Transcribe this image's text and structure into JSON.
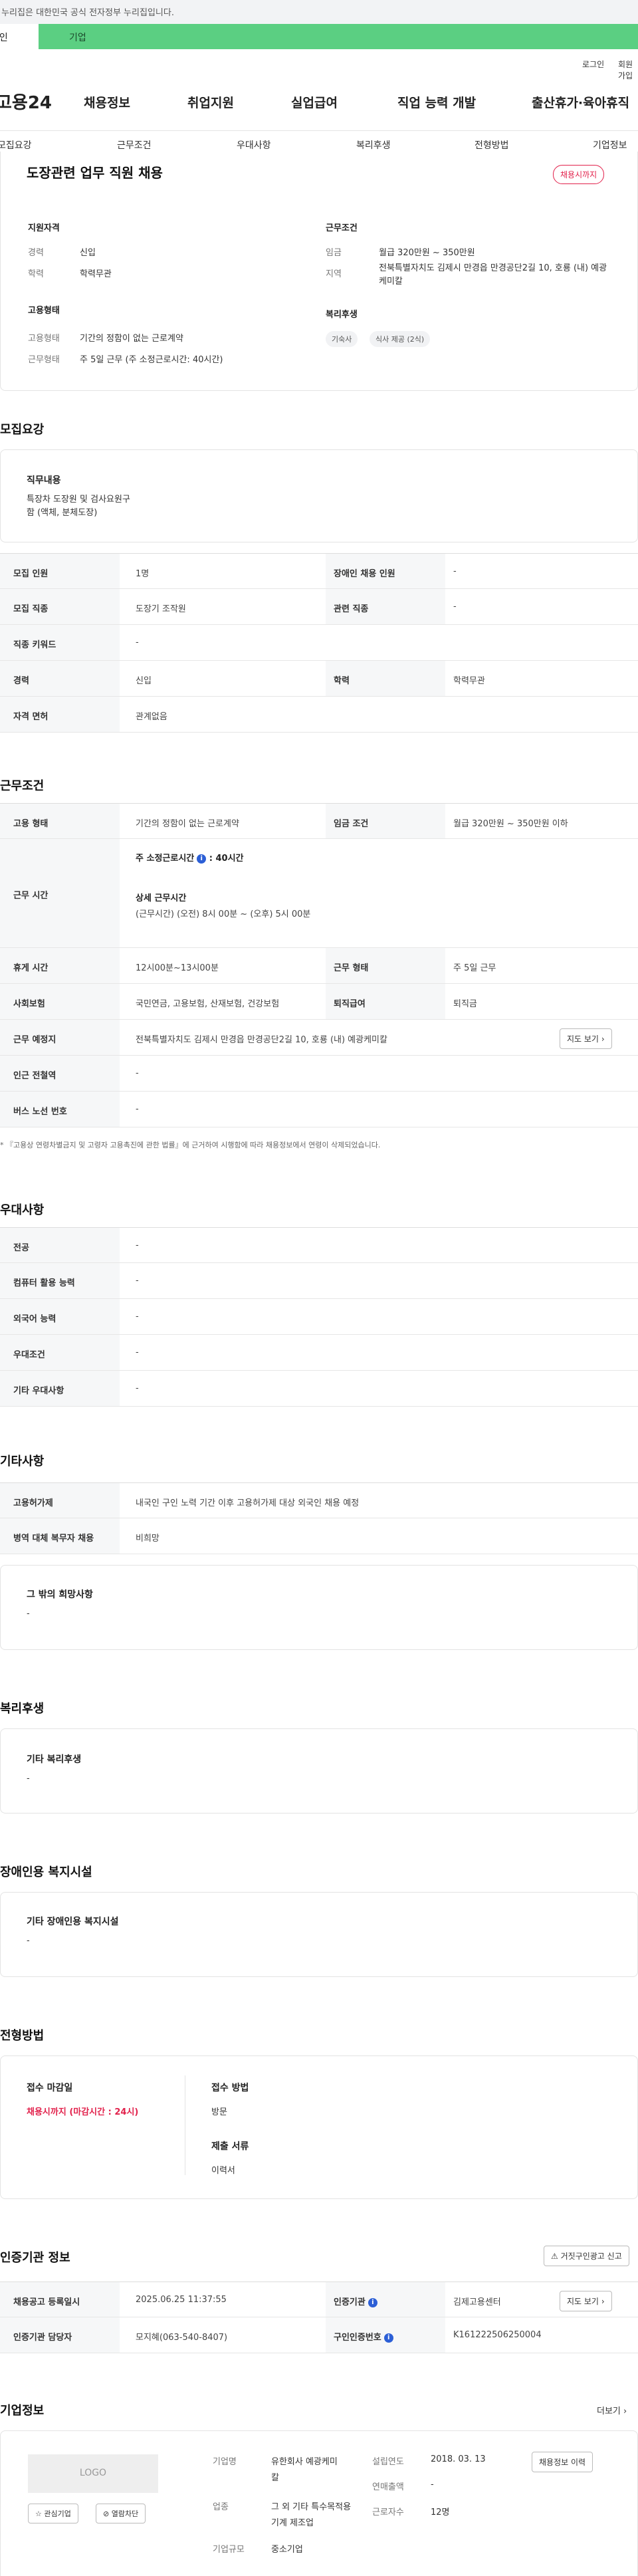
{
  "gov_banner": {
    "text": "이 누리집은 대한민국 공식 전자정부 누리집입니다."
  },
  "user_tabs": {
    "personal": "개인",
    "company": "기업"
  },
  "util_links": {
    "login": "로그인",
    "signup": "회원가입"
  },
  "header": {
    "logo": "고용24",
    "gnb": [
      "채용정보",
      "취업지원",
      "실업급여",
      "직업 능력 개발",
      "출산휴가·육아휴직"
    ]
  },
  "subnav": [
    "모집요강",
    "근무조건",
    "우대사항",
    "복리후생",
    "전형방법",
    "기업정보"
  ],
  "summary": {
    "job_title": "도장관련 업무 직원 채용",
    "status_badge": "채용시까지",
    "qual_heading": "지원자격",
    "career_label": "경력",
    "career_value": "신입",
    "edu_label": "학력",
    "edu_value": "학력무관",
    "cond_heading": "근무조건",
    "wage_label": "임금",
    "wage_value": "월급 320만원 ~ 350만원",
    "region_label": "지역",
    "region_value": "전북특별자치도 김제시 만경읍 만경공단2길 10, 호룡 (내) 예광케미칼",
    "emp_heading": "고용형태",
    "emptype_label": "고용형태",
    "emptype_value": "기간의 정함이 없는 근로계약",
    "worktype_label": "근무형태",
    "worktype_value": "주 5일 근무 (주 소정근로시간: 40시간)",
    "welfare_heading": "복리후생",
    "welfare_chips": [
      "기숙사",
      "식사 제공 (2식)"
    ]
  },
  "recruit": {
    "heading": "모집요강",
    "duty_heading": "직무내용",
    "duty_text": "특장차 도장원 및 검사요원구함 (액체, 분체도장)",
    "rows": [
      {
        "label": "모집 인원",
        "value": "1명",
        "label2": "장애인 채용 인원",
        "value2": "-"
      },
      {
        "label": "모집 직종",
        "value": "도장기 조작원",
        "label2": "관련 직종",
        "value2": "-"
      },
      {
        "label": "직종 키워드",
        "value": "-"
      },
      {
        "label": "경력",
        "value": "신입",
        "label2": "학력",
        "value2": "학력무관"
      },
      {
        "label": "자격 면허",
        "value": "관계없음"
      }
    ]
  },
  "work": {
    "heading": "근무조건",
    "emptype_label": "고용 형태",
    "emptype_value": "기간의 정함이 없는 근로계약",
    "wage_label": "임금 조건",
    "wage_value": "월급 320만원 ~ 350만원 이하",
    "hours_label": "근무 시간",
    "weekly_hours_title": "주 소정근로시간",
    "weekly_hours_value": ": 40시간",
    "detail_title": "상세 근무시간",
    "detail_value": "(근무시간) (오전) 8시 00분 ~ (오후) 5시 00분",
    "break_label": "휴게 시간",
    "break_value": "12시00분~13시00분",
    "form_label": "근무 형태",
    "form_value": "주 5일 근무",
    "ins_label": "사회보험",
    "ins_value": "국민연금, 고용보험, 산재보험, 건강보험",
    "sev_label": "퇴직급여",
    "sev_value": "퇴직금",
    "place_label": "근무 예정지",
    "place_value": "전북특별자치도 김제시 만경읍 만경공단2길 10, 호룡 (내) 예광케미칼",
    "map_button": "지도 보기",
    "subway_label": "인근 전철역",
    "subway_value": "-",
    "bus_label": "버스 노선 번호",
    "bus_value": "-",
    "note": "* 『고용상 연령차별금지 및 고령자 고용촉진에 관한 법률』에 근거하여 시행함에 따라 채용정보에서 연령이 삭제되었습니다."
  },
  "pref": {
    "heading": "우대사항",
    "rows": [
      {
        "label": "전공",
        "value": "-"
      },
      {
        "label": "컴퓨터 활용 능력",
        "value": "-"
      },
      {
        "label": "외국어 능력",
        "value": "-"
      },
      {
        "label": "우대조건",
        "value": "-"
      },
      {
        "label": "기타 우대사항",
        "value": "-"
      }
    ]
  },
  "etc": {
    "heading": "기타사항",
    "foreign_label": "고용허가제",
    "foreign_value": "내국인 구인 노력 기간 이후 고용허가제 대상 외국인 채용 예정",
    "military_label": "병역 대체 복무자 채용",
    "military_value": "비희망",
    "other_title": "그 밖의 희망사항",
    "other_value": "-"
  },
  "welfare": {
    "heading": "복리후생",
    "title": "기타 복리후생",
    "value": "-"
  },
  "disability": {
    "heading": "장애인용 복지시설",
    "title": "기타 장애인용 복지시설",
    "value": "-"
  },
  "process": {
    "heading": "전형방법",
    "deadline_title": "접수 마감일",
    "deadline_value": "채용시까지 (마감시간 : 24시)",
    "method_title": "접수 방법",
    "method_value": "방문",
    "docs_title": "제출 서류",
    "docs_value": "이력서"
  },
  "cert": {
    "heading": "인증기관 정보",
    "report_button": "거짓구인광고 신고",
    "reg_label": "채용공고 등록일시",
    "reg_value": "2025.06.25 11:37:55",
    "org_label": "인증기관",
    "org_value": "김제고용센터",
    "map_button": "지도 보기",
    "manager_label": "인증기관 담당자",
    "manager_value": "모지혜(063-540-8407)",
    "certno_label": "구인인증번호",
    "certno_value": "K161222506250004"
  },
  "company": {
    "heading": "기업정보",
    "more_link": "더보기",
    "logo_text": "LOGO",
    "fav_button": "관심기업",
    "block_button": "열람차단",
    "name_label": "기업명",
    "name_value": "유한회사 예광케미칼",
    "industry_label": "업종",
    "industry_value": "그 외 기타 특수목적용 기계 제조업",
    "size_label": "기업규모",
    "size_value": "중소기업",
    "founded_label": "설립연도",
    "founded_value": "2018. 03. 13",
    "sales_label": "연매출액",
    "sales_value": "-",
    "staff_label": "근로자수",
    "staff_value": "12명",
    "history_button": "채용정보 이력"
  }
}
